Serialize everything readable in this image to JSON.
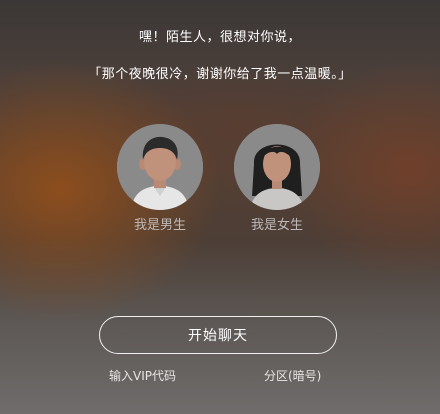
{
  "header": {
    "line1": "嘿！陌生人，很想对你说，",
    "line2": "「那个夜晚很冷，谢谢你给了我一点温暖。」"
  },
  "gender_options": [
    {
      "label": "我是男生",
      "icon": "male-avatar-icon"
    },
    {
      "label": "我是女生",
      "icon": "female-avatar-icon"
    }
  ],
  "actions": {
    "start_label": "开始聊天",
    "vip_code_label": "输入VIP代码",
    "zone_label": "分区(暗号)"
  },
  "colors": {
    "accent_text": "#ffffff",
    "muted_text": "#bdbab8",
    "avatar_bg": "#8a8a8a"
  }
}
